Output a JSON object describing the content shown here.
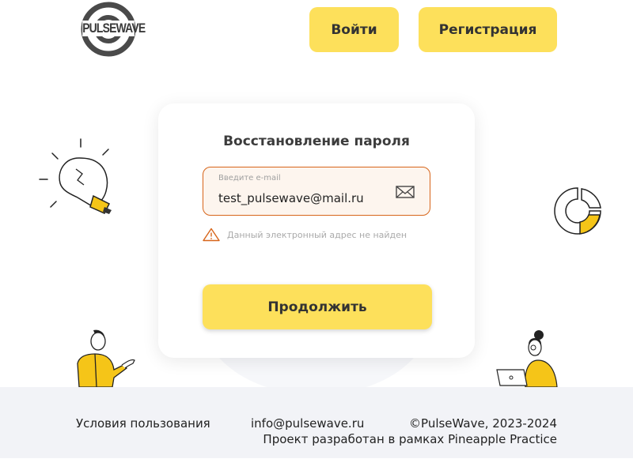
{
  "brand": {
    "logo_text": "PULSEWAVE"
  },
  "header": {
    "login_label": "Войти",
    "register_label": "Регистрация"
  },
  "card": {
    "title": "Восстановление пароля",
    "email_label": "Введите e-mail",
    "email_value": "test_pulsewave@mail.ru",
    "error_text": "Данный электронный адрес не найден",
    "continue_label": "Продолжить"
  },
  "footer": {
    "terms": "Условия пользования",
    "email": "info@pulsewave.ru",
    "copyright": "©PulseWave, 2023-2024",
    "project": "Проект разработан в рамках Pineapple Practice"
  },
  "colors": {
    "accent": "#fde05b",
    "error_border": "#d7651a",
    "field_bg": "#fdf5ee",
    "footer_bg": "#f2f3f7"
  },
  "icons": [
    "mail-icon",
    "warning-icon",
    "lightbulb-icon",
    "donut-chart-icon"
  ]
}
